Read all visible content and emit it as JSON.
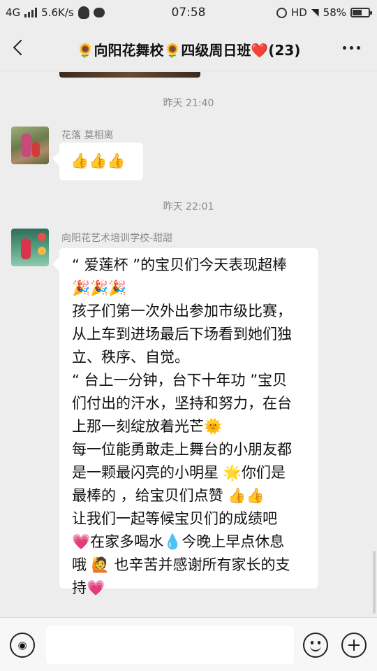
{
  "status_bar": {
    "network": "4G",
    "speed": "5.6K/s",
    "time": "07:58",
    "hd": "HD",
    "battery_text": "58%",
    "battery_level": 0.58,
    "icons": [
      "signal-icon",
      "qq-icon",
      "message-icon",
      "alarm-icon",
      "wifi-icon",
      "battery-icon"
    ]
  },
  "header": {
    "title": "🌻向阳花舞校🌻四级周日班❤️(23)"
  },
  "messages": [
    {
      "timestamp": "昨天 21:40",
      "sender": "花落 莫相离",
      "text": "👍👍👍"
    },
    {
      "timestamp": "昨天 22:01",
      "sender": "向阳花艺术培训学校-甜甜",
      "lines": [
        "“ 爱莲杯 ”的宝贝们今天表现超棒",
        "🎉🎉🎉",
        "孩子们第一次外出参加市级比赛，",
        "从上车到进场最后下场看到她们独",
        "立、秩序、自觉。",
        "“ 台上一分钟，台下十年功 ”宝贝",
        "们付出的汗水，坚持和努力，在台",
        "上那一刻绽放着光芒🌞",
        "每一位能勇敢走上舞台的小朋友都",
        "是一颗最闪亮的小明星 🌟你们是",
        "最棒的 ，给宝贝们点赞 👍👍",
        "让我们一起等候宝贝们的成绩吧",
        "💗在家多喝水💧今晚上早点休息",
        "哦 🙋 也辛苦并感谢所有家长的支",
        "持💗"
      ]
    }
  ],
  "input": {
    "value": ""
  }
}
